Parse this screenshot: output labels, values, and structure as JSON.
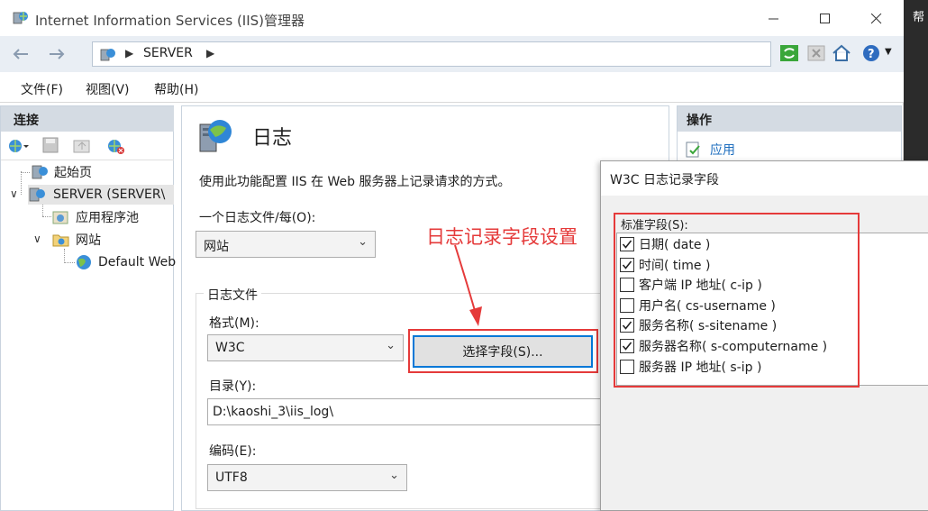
{
  "window": {
    "title": "Internet Information Services (IIS)管理器",
    "address_crumb": "SERVER",
    "strip_text": "帮"
  },
  "menu": [
    "文件(F)",
    "视图(V)",
    "帮助(H)"
  ],
  "connections": {
    "header": "连接",
    "tree": {
      "start_page": "起始页",
      "server": "SERVER (SERVER\\",
      "app_pools": "应用程序池",
      "sites": "网站",
      "default_site": "Default Web"
    }
  },
  "feature": {
    "title": "日志",
    "description": "使用此功能配置 IIS 在 Web 服务器上记录请求的方式。",
    "one_log_label": "一个日志文件/每(O):",
    "one_log_value": "网站",
    "log_file_group": "日志文件",
    "format_label": "格式(M):",
    "format_value": "W3C",
    "select_fields_button": "选择字段(S)...",
    "directory_label": "目录(Y):",
    "directory_value": "D:\\kaoshi_3\\iis_log\\",
    "encoding_label": "编码(E):",
    "encoding_value": "UTF8"
  },
  "actions": {
    "header": "操作",
    "apply": "应用"
  },
  "annotation": "日志记录字段设置",
  "w3c_dialog": {
    "title": "W3C 日志记录字段",
    "standard_fields_label": "标准字段(S):",
    "fields": [
      {
        "label": "日期( date )",
        "checked": true
      },
      {
        "label": "时间( time )",
        "checked": true
      },
      {
        "label": "客户端 IP 地址( c-ip )",
        "checked": false
      },
      {
        "label": "用户名( cs-username )",
        "checked": false
      },
      {
        "label": "服务名称( s-sitename )",
        "checked": true
      },
      {
        "label": "服务器名称( s-computername )",
        "checked": true
      },
      {
        "label": "服务器 IP 地址( s-ip )",
        "checked": false
      }
    ]
  },
  "colors": {
    "highlight_red": "#e53a3a",
    "link_blue": "#1f6fbf",
    "pane_header": "#d4dbe3"
  }
}
